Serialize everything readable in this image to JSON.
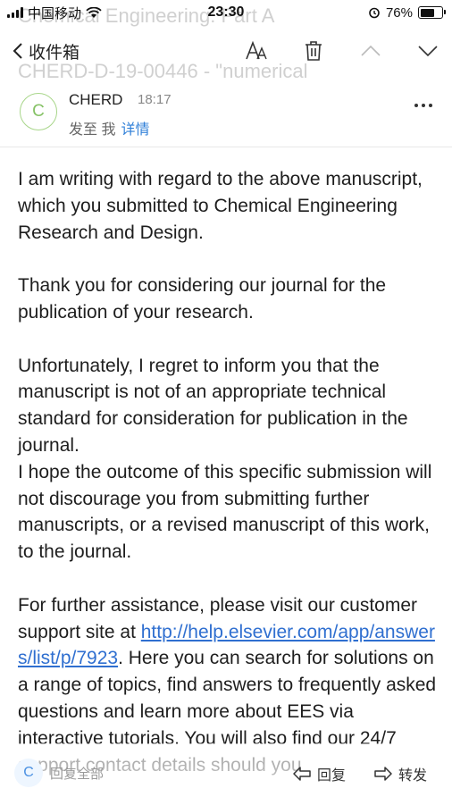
{
  "status_bar": {
    "carrier": "中国移动",
    "time": "23:30",
    "battery": "76%",
    "battery_level": 0.76
  },
  "ghost_subject": {
    "line1": "Chemical Engineering: Part A",
    "line2": "CHERD-D-19-00446 - \"numerical"
  },
  "nav": {
    "back_label": "收件箱"
  },
  "header": {
    "avatar_letter": "C",
    "sender": "CHERD",
    "time": "18:17",
    "to_prefix": "发至 我",
    "details": "详情"
  },
  "body": {
    "p1": "I am writing with regard to the above manuscript, which you submitted to Chemical Engineering Research and Design.",
    "p2": "Thank you for considering our journal for the publication of your research.",
    "p3": "Unfortunately, I regret to inform you that the manuscript is not of an appropriate technical standard for consideration for publication in the journal.",
    "p4": "I hope the outcome of this specific submission will not discourage you from submitting further manuscripts, or a revised manuscript of this work,  to the journal.",
    "p5_prefix": "For further assistance, please visit our customer support site at ",
    "link": "http://help.elsevier.com/app/answers/list/p/7923",
    "p5_suffix": ". Here you can search for solutions on a range of topics, find answers to frequently asked questions and learn more about EES via interactive tutorials. You will also find our 24/7 support contact details should you"
  },
  "toolbar": {
    "avatar_letter": "C",
    "reply_all": "回复全部",
    "reply": "回复",
    "forward": "转发"
  }
}
